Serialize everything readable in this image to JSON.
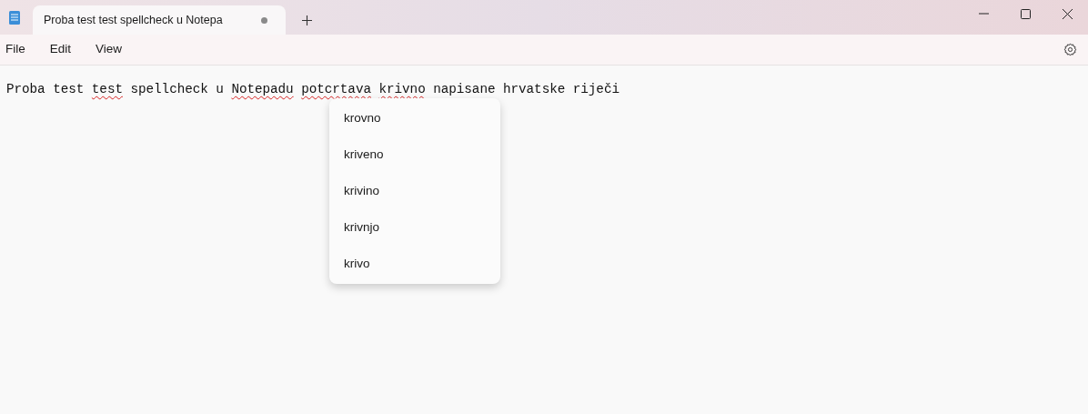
{
  "tab": {
    "title": "Proba test test spellcheck u Notepa",
    "unsaved": true
  },
  "menu": [
    "File",
    "Edit",
    "View"
  ],
  "document": {
    "words": [
      {
        "text": "Proba",
        "misspelled": false
      },
      {
        "text": "test",
        "misspelled": false
      },
      {
        "text": "test",
        "misspelled": true
      },
      {
        "text": "spellcheck",
        "misspelled": false
      },
      {
        "text": "u",
        "misspelled": false
      },
      {
        "text": "Notepadu",
        "misspelled": true
      },
      {
        "text": "potcrtava",
        "misspelled": true
      },
      {
        "text": "krivno",
        "misspelled": true
      },
      {
        "text": "napisane",
        "misspelled": false
      },
      {
        "text": "hrvatske",
        "misspelled": false
      },
      {
        "text": "riječi",
        "misspelled": false
      }
    ]
  },
  "suggestions": [
    "krovno",
    "kriveno",
    "krivino",
    "krivnjo",
    "krivo"
  ]
}
